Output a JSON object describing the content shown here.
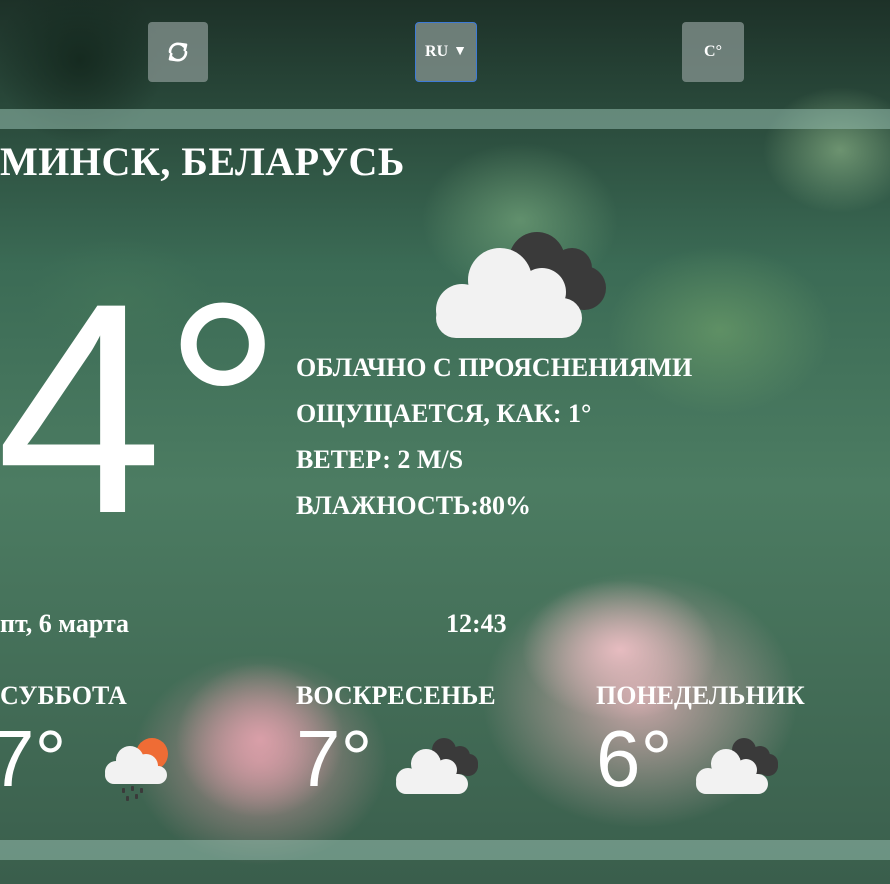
{
  "controls": {
    "refresh_icon": "refresh-icon",
    "language": "RU",
    "language_caret": "▼",
    "unit": "C°"
  },
  "location": "МИНСК, БЕЛАРУСЬ",
  "current": {
    "temperature": "4°",
    "icon": "cloudy-icon",
    "condition": "ОБЛАЧНО С ПРОЯСНЕНИЯМИ",
    "feels_like": "ОЩУЩАЕТСЯ, КАК: 1°",
    "wind": "ВЕТЕР: 2 M/S",
    "humidity": "ВЛАЖНОСТЬ:80%"
  },
  "date": "пт, 6 марта",
  "time": "12:43",
  "forecast": [
    {
      "day": "СУББОТА",
      "temperature": "7°",
      "icon": "rain-sun-icon"
    },
    {
      "day": "ВОСКРЕСЕНЬЕ",
      "temperature": "7°",
      "icon": "cloudy-icon"
    },
    {
      "day": "ПОНЕДЕЛЬНИК",
      "temperature": "6°",
      "icon": "cloudy-icon"
    }
  ],
  "colors": {
    "text": "#ffffff",
    "control_bg": "#87968f",
    "select_border": "#3f7bd6",
    "band": "#96beaf",
    "cloud_light": "#f2f2f2",
    "cloud_dark": "#3a3a3a",
    "sun": "#ef6c35"
  }
}
